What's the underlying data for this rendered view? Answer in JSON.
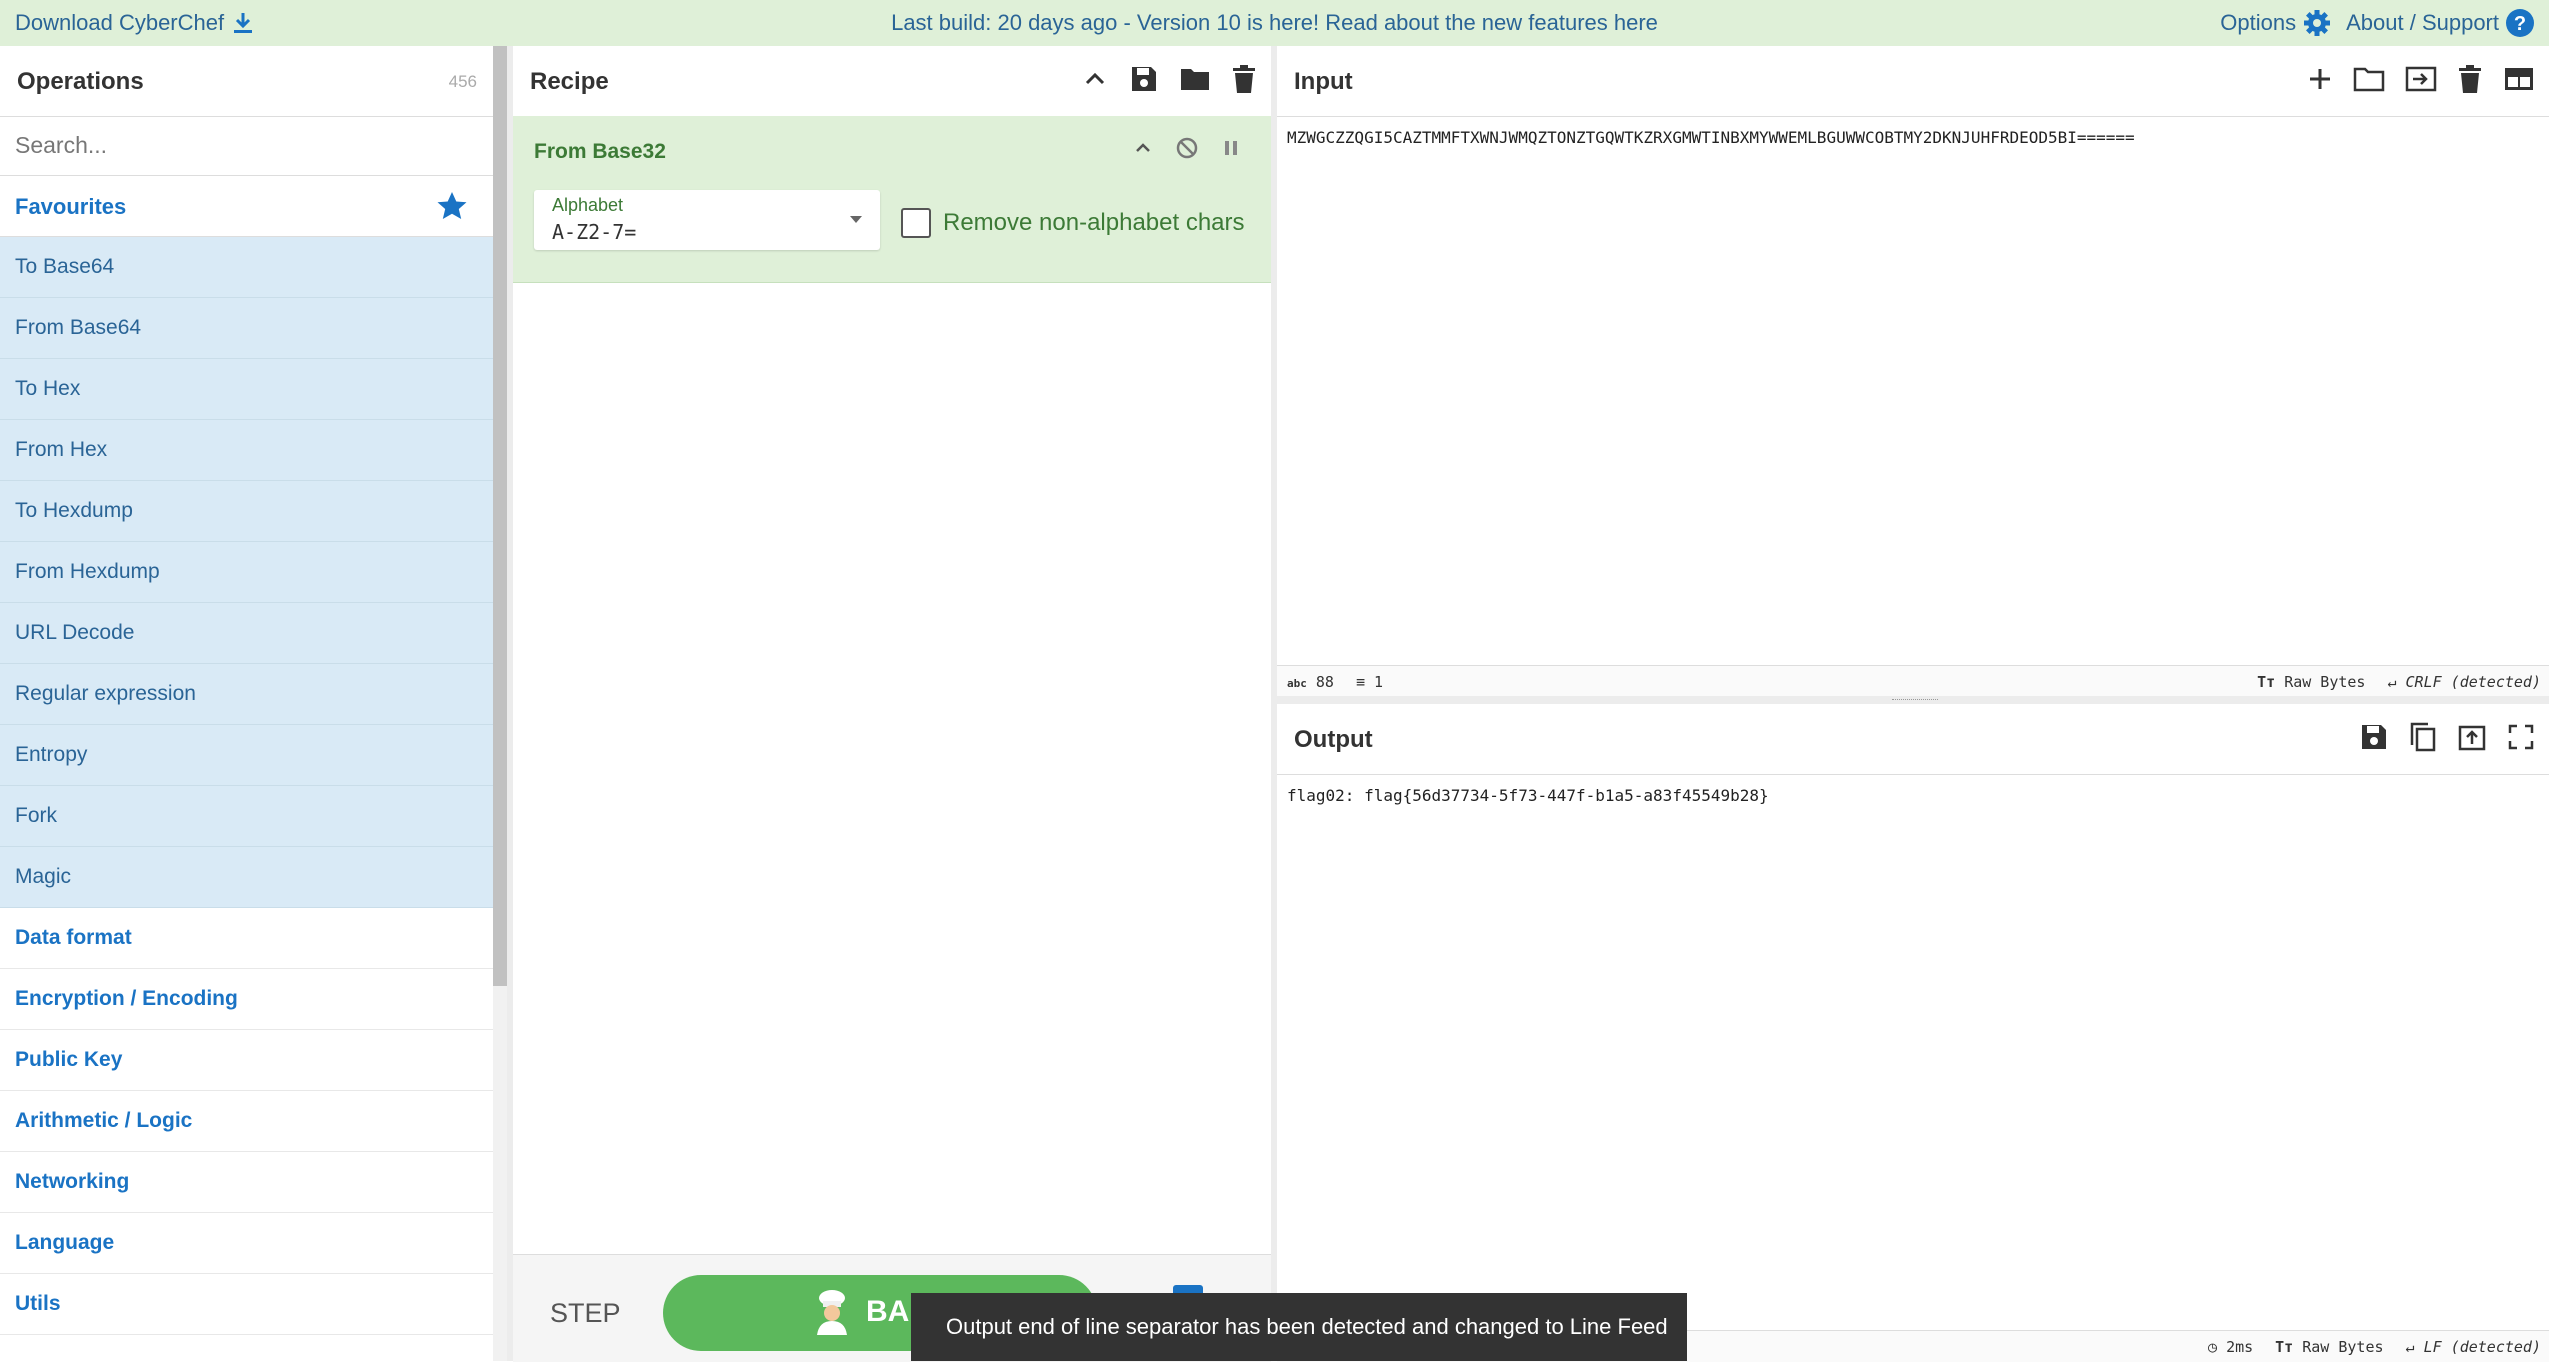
{
  "topbar": {
    "download_label": "Download CyberChef",
    "notice_text": "Last build: 20 days ago - Version 10 is here! Read about the new features here",
    "options_label": "Options",
    "about_label": "About / Support"
  },
  "operations": {
    "title": "Operations",
    "count": "456",
    "search_placeholder": "Search...",
    "favourites_label": "Favourites",
    "favourites": [
      "To Base64",
      "From Base64",
      "To Hex",
      "From Hex",
      "To Hexdump",
      "From Hexdump",
      "URL Decode",
      "Regular expression",
      "Entropy",
      "Fork",
      "Magic"
    ],
    "categories": [
      "Data format",
      "Encryption / Encoding",
      "Public Key",
      "Arithmetic / Logic",
      "Networking",
      "Language",
      "Utils"
    ]
  },
  "recipe": {
    "title": "Recipe",
    "operation_name": "From Base32",
    "alphabet_label": "Alphabet",
    "alphabet_value": "A-Z2-7=",
    "remove_label": "Remove non-alphabet chars",
    "step_label": "STEP",
    "bake_label": "BA"
  },
  "input": {
    "title": "Input",
    "text": "MZWGCZZQGI5CAZTMMFTXWNJWMQZTONZTGQWTKZRXGMWTINBXMYWWEMLBGUWWCOBTMY2DKNJUHFRDEOD5BI======",
    "length": "88",
    "lines": "1",
    "encoding": "Raw Bytes",
    "eol": "CRLF (detected)"
  },
  "output": {
    "title": "Output",
    "text": "flag02: flag{56d37734-5f73-447f-b1a5-a83f45549b28}",
    "time": "2ms",
    "encoding": "Raw Bytes",
    "eol": "LF (detected)"
  },
  "toast": {
    "message": "Output end of line separator has been detected and changed to Line Feed"
  },
  "colors": {
    "topbar_bg": "#dff0d8",
    "link_blue": "#1a73c4",
    "favourite_bg": "#d9eaf6",
    "recipe_op_bg": "#dff0d8",
    "bake_green": "#5cb85c"
  }
}
